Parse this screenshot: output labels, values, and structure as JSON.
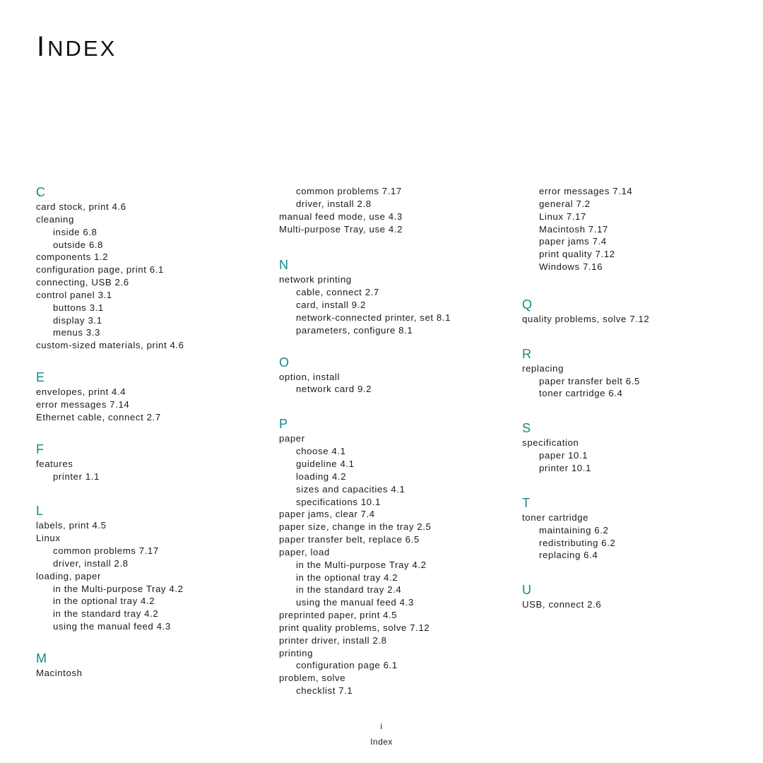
{
  "page": {
    "title_first": "I",
    "title_rest": "NDEX",
    "footer_page": "i",
    "footer_label": "Index"
  },
  "columns": [
    {
      "sections": [
        {
          "letter": "C",
          "entries": [
            {
              "text": "card stock, print 4.6",
              "level": 0
            },
            {
              "text": "cleaning",
              "level": 0
            },
            {
              "text": "inside 6.8",
              "level": 1
            },
            {
              "text": "outside 6.8",
              "level": 1
            },
            {
              "text": "components 1.2",
              "level": 0
            },
            {
              "text": "configuration page, print 6.1",
              "level": 0
            },
            {
              "text": "connecting, USB 2.6",
              "level": 0
            },
            {
              "text": "control panel 3.1",
              "level": 0
            },
            {
              "text": "buttons 3.1",
              "level": 1
            },
            {
              "text": "display 3.1",
              "level": 1
            },
            {
              "text": "menus 3.3",
              "level": 1
            },
            {
              "text": "custom-sized materials, print 4.6",
              "level": 0
            }
          ]
        },
        {
          "letter": "E",
          "entries": [
            {
              "text": "envelopes, print 4.4",
              "level": 0
            },
            {
              "text": "error messages 7.14",
              "level": 0
            },
            {
              "text": "Ethernet cable, connect 2.7",
              "level": 0
            }
          ]
        },
        {
          "letter": "F",
          "entries": [
            {
              "text": "features",
              "level": 0
            },
            {
              "text": "printer 1.1",
              "level": 1
            }
          ]
        },
        {
          "letter": "L",
          "entries": [
            {
              "text": "labels, print 4.5",
              "level": 0
            },
            {
              "text": "Linux",
              "level": 0
            },
            {
              "text": "common problems 7.17",
              "level": 1
            },
            {
              "text": "driver, install 2.8",
              "level": 1
            },
            {
              "text": "loading, paper",
              "level": 0
            },
            {
              "text": "in the Multi-purpose Tray 4.2",
              "level": 1
            },
            {
              "text": "in the optional tray 4.2",
              "level": 1
            },
            {
              "text": "in the standard tray 4.2",
              "level": 1
            },
            {
              "text": "using the manual feed 4.3",
              "level": 1
            }
          ]
        },
        {
          "letter": "M",
          "entries": [
            {
              "text": "Macintosh",
              "level": 0
            }
          ]
        }
      ]
    },
    {
      "sections": [
        {
          "letter": "",
          "entries": [
            {
              "text": "common problems 7.17",
              "level": 1
            },
            {
              "text": "driver, install 2.8",
              "level": 1
            },
            {
              "text": "manual feed mode, use 4.3",
              "level": 0
            },
            {
              "text": "Multi-purpose Tray, use 4.2",
              "level": 0
            }
          ]
        },
        {
          "letter": "N",
          "entries": [
            {
              "text": "network printing",
              "level": 0
            },
            {
              "text": "cable, connect 2.7",
              "level": 1
            },
            {
              "text": "card, install 9.2",
              "level": 1
            },
            {
              "text": "network-connected printer, set 8.1",
              "level": 1
            },
            {
              "text": "parameters, configure 8.1",
              "level": 1
            }
          ]
        },
        {
          "letter": "O",
          "entries": [
            {
              "text": "option, install",
              "level": 0
            },
            {
              "text": "network card 9.2",
              "level": 1
            }
          ]
        },
        {
          "letter": "P",
          "entries": [
            {
              "text": "paper",
              "level": 0
            },
            {
              "text": "choose 4.1",
              "level": 1
            },
            {
              "text": "guideline 4.1",
              "level": 1
            },
            {
              "text": "loading 4.2",
              "level": 1
            },
            {
              "text": "sizes and capacities 4.1",
              "level": 1
            },
            {
              "text": "specifications 10.1",
              "level": 1
            },
            {
              "text": "paper jams, clear 7.4",
              "level": 0
            },
            {
              "text": "paper size, change in the tray 2.5",
              "level": 0
            },
            {
              "text": "paper transfer belt, replace 6.5",
              "level": 0
            },
            {
              "text": "paper, load",
              "level": 0
            },
            {
              "text": "in the Multi-purpose Tray 4.2",
              "level": 1
            },
            {
              "text": "in the optional tray 4.2",
              "level": 1
            },
            {
              "text": "in the standard tray 2.4",
              "level": 1
            },
            {
              "text": "using the manual feed 4.3",
              "level": 1
            },
            {
              "text": "preprinted paper, print 4.5",
              "level": 0
            },
            {
              "text": "print quality problems, solve 7.12",
              "level": 0
            },
            {
              "text": "printer driver, install 2.8",
              "level": 0
            },
            {
              "text": "printing",
              "level": 0
            },
            {
              "text": "configuration page 6.1",
              "level": 1
            },
            {
              "text": "problem, solve",
              "level": 0
            },
            {
              "text": "checklist 7.1",
              "level": 1
            }
          ]
        }
      ]
    },
    {
      "sections": [
        {
          "letter": "",
          "entries": [
            {
              "text": "error messages 7.14",
              "level": 1
            },
            {
              "text": "general 7.2",
              "level": 1
            },
            {
              "text": "Linux 7.17",
              "level": 1
            },
            {
              "text": "Macintosh 7.17",
              "level": 1
            },
            {
              "text": "paper jams 7.4",
              "level": 1
            },
            {
              "text": "print quality 7.12",
              "level": 1
            },
            {
              "text": "Windows 7.16",
              "level": 1
            }
          ]
        },
        {
          "letter": "Q",
          "entries": [
            {
              "text": "quality problems, solve 7.12",
              "level": 0
            }
          ]
        },
        {
          "letter": "R",
          "entries": [
            {
              "text": "replacing",
              "level": 0
            },
            {
              "text": "paper transfer belt 6.5",
              "level": 1
            },
            {
              "text": "toner cartridge 6.4",
              "level": 1
            }
          ]
        },
        {
          "letter": "S",
          "entries": [
            {
              "text": "specification",
              "level": 0
            },
            {
              "text": "paper 10.1",
              "level": 1
            },
            {
              "text": "printer 10.1",
              "level": 1
            }
          ]
        },
        {
          "letter": "T",
          "entries": [
            {
              "text": "toner cartridge",
              "level": 0
            },
            {
              "text": "maintaining 6.2",
              "level": 1
            },
            {
              "text": "redistributing 6.2",
              "level": 1
            },
            {
              "text": "replacing 6.4",
              "level": 1
            }
          ]
        },
        {
          "letter": "U",
          "entries": [
            {
              "text": "USB, connect 2.6",
              "level": 0
            }
          ]
        }
      ]
    }
  ],
  "colors": {
    "letter_heading": "#0f8a8a",
    "text": "#1a1a1a"
  }
}
